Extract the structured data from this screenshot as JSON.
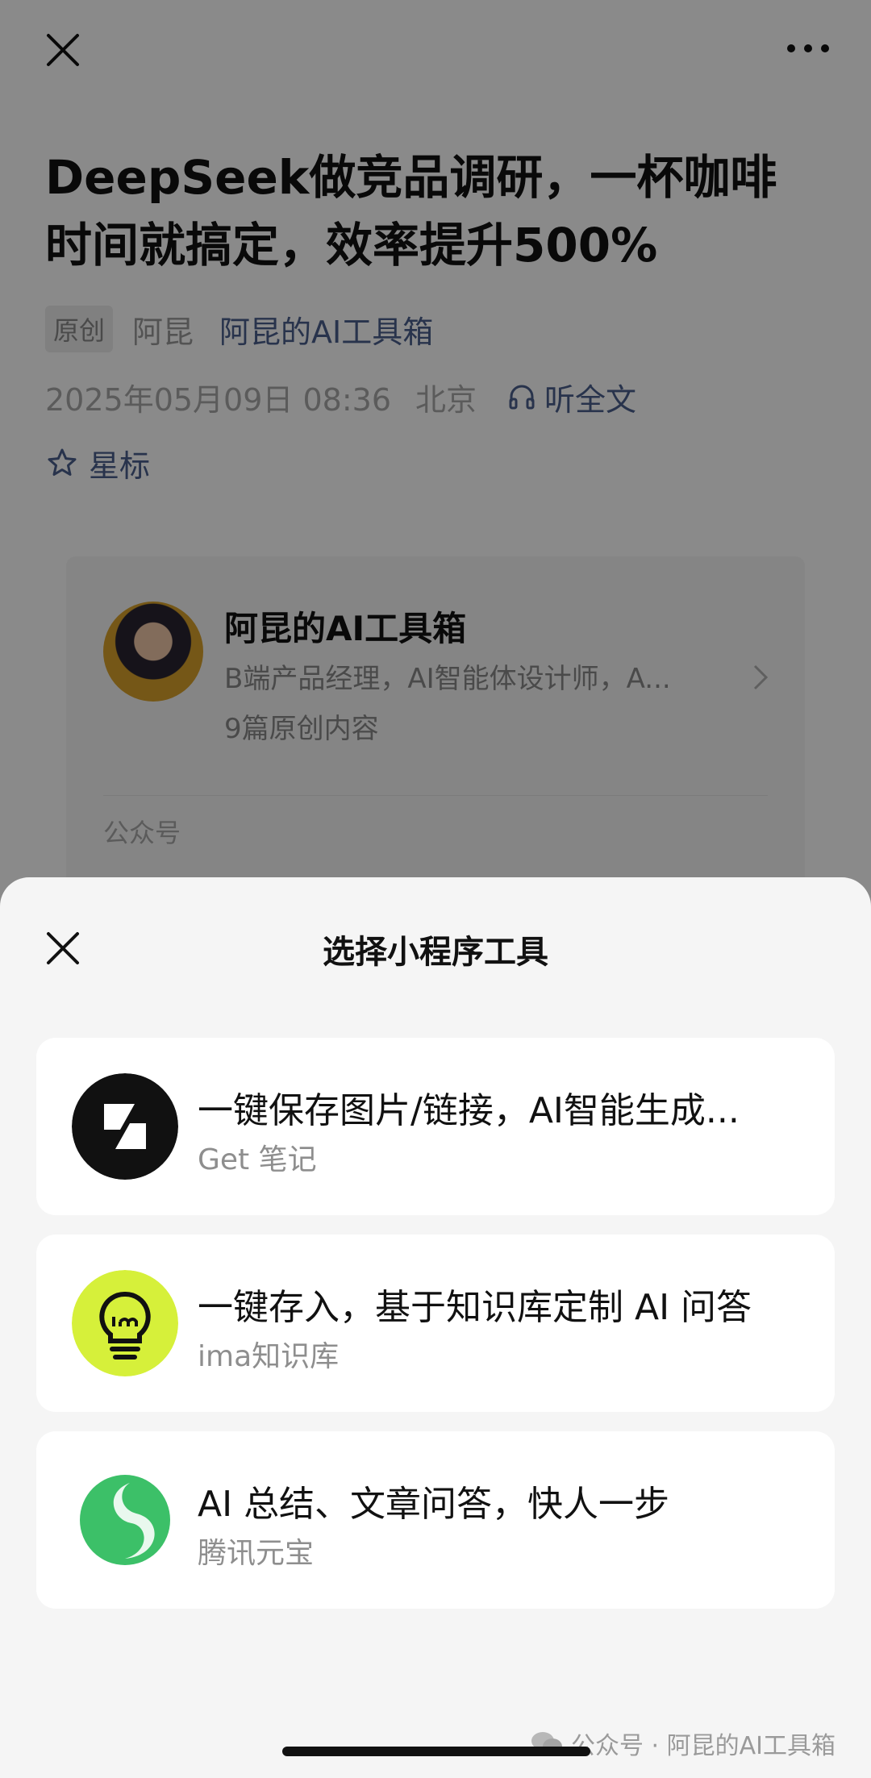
{
  "article": {
    "title": "DeepSeek做竞品调研，一杯咖啡时间就搞定，效率提升500%",
    "tag": "原创",
    "author": "阿昆",
    "account": "阿昆的AI工具箱",
    "datetime": "2025年05月09日 08:36",
    "location": "北京",
    "listen_label": "听全文",
    "star_label": "星标"
  },
  "profile_card": {
    "name": "阿昆的AI工具箱",
    "description": "B端产品经理，AI智能体设计师，A...",
    "count": "9篇原创内容",
    "footer": "公众号"
  },
  "sheet": {
    "title": "选择小程序工具",
    "tools": [
      {
        "desc": "一键保存图片/链接，AI智能生成...",
        "name": "Get 笔记",
        "icon": "get-notes-icon",
        "color": "#111111"
      },
      {
        "desc": "一键存入，基于知识库定制 AI 问答",
        "name": "ima知识库",
        "icon": "ima-bulb-icon",
        "color": "#d6f03a"
      },
      {
        "desc": "AI 总结、文章问答，快人一步",
        "name": "腾讯元宝",
        "icon": "yuanbao-icon",
        "color": "#3cc068"
      }
    ]
  },
  "watermark": "公众号 · 阿昆的AI工具箱",
  "icons": [
    "close-icon",
    "more-icon",
    "headphone-icon",
    "star-icon",
    "chevron-right-icon",
    "wechat-icon"
  ]
}
